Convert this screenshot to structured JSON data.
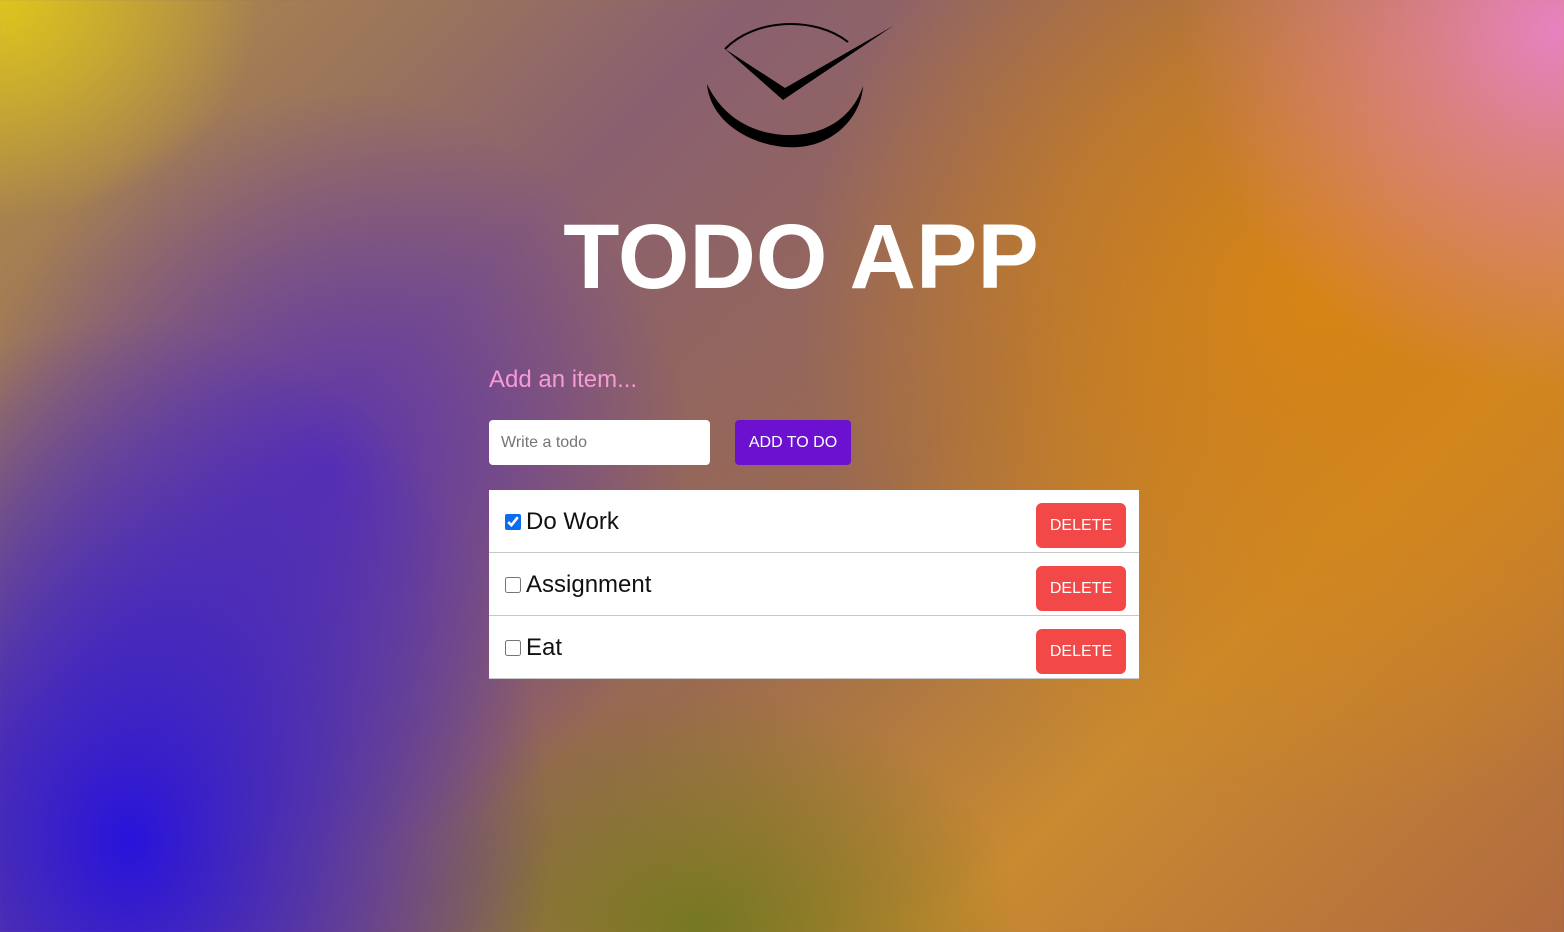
{
  "logo": {
    "icon": "check-clock-logo-icon"
  },
  "header": {
    "title": "TODO APP"
  },
  "form": {
    "heading": "Add an item...",
    "input_placeholder": "Write a todo",
    "input_value": "",
    "add_label": "ADD TO DO"
  },
  "todos": [
    {
      "label": "Do Work",
      "checked": true,
      "delete_label": "DELETE"
    },
    {
      "label": "Assignment",
      "checked": false,
      "delete_label": "DELETE"
    },
    {
      "label": "Eat",
      "checked": false,
      "delete_label": "DELETE"
    }
  ],
  "colors": {
    "add_button": "#6d11d0",
    "delete_button": "#f24848",
    "heading_pink": "#f79ad6"
  }
}
